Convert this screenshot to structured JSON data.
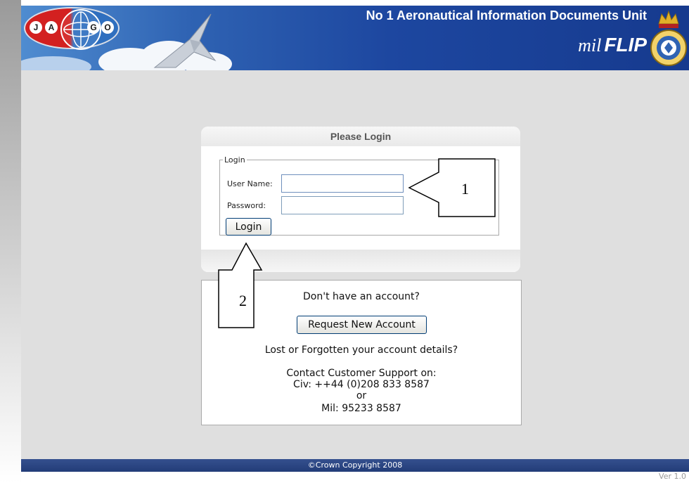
{
  "header": {
    "logo_letters": [
      "J",
      "A",
      "G",
      "O"
    ],
    "title": "No 1 Aeronautical Information Documents Unit",
    "brand_prefix": "mil",
    "brand_name": "FLIP",
    "icons": [
      "jago-globe-logo",
      "typhoon-jet-image",
      "raf-crest-icon"
    ],
    "colors": {
      "banner": "#1d47a0",
      "logo_red": "#d32020",
      "logo_blue": "#2f6fbf"
    }
  },
  "login": {
    "panel_title": "Please Login",
    "legend": "Login",
    "username_label": "User Name:",
    "username_value": "",
    "password_label": "Password:",
    "password_value": "",
    "login_button": "Login"
  },
  "callouts": {
    "one": "1",
    "two": "2"
  },
  "account": {
    "question": "Don't have an account?",
    "request_button": "Request New Account",
    "lost_text": "Lost or Forgotten your account details?",
    "contact_line": "Contact Customer Support on:",
    "civ_line": "Civ: ++44 (0)208 833 8587",
    "or_line": "or",
    "mil_line": "Mil: 95233 8587"
  },
  "footer": {
    "copyright": "©Crown Copyright 2008",
    "version": "Ver 1.0"
  }
}
